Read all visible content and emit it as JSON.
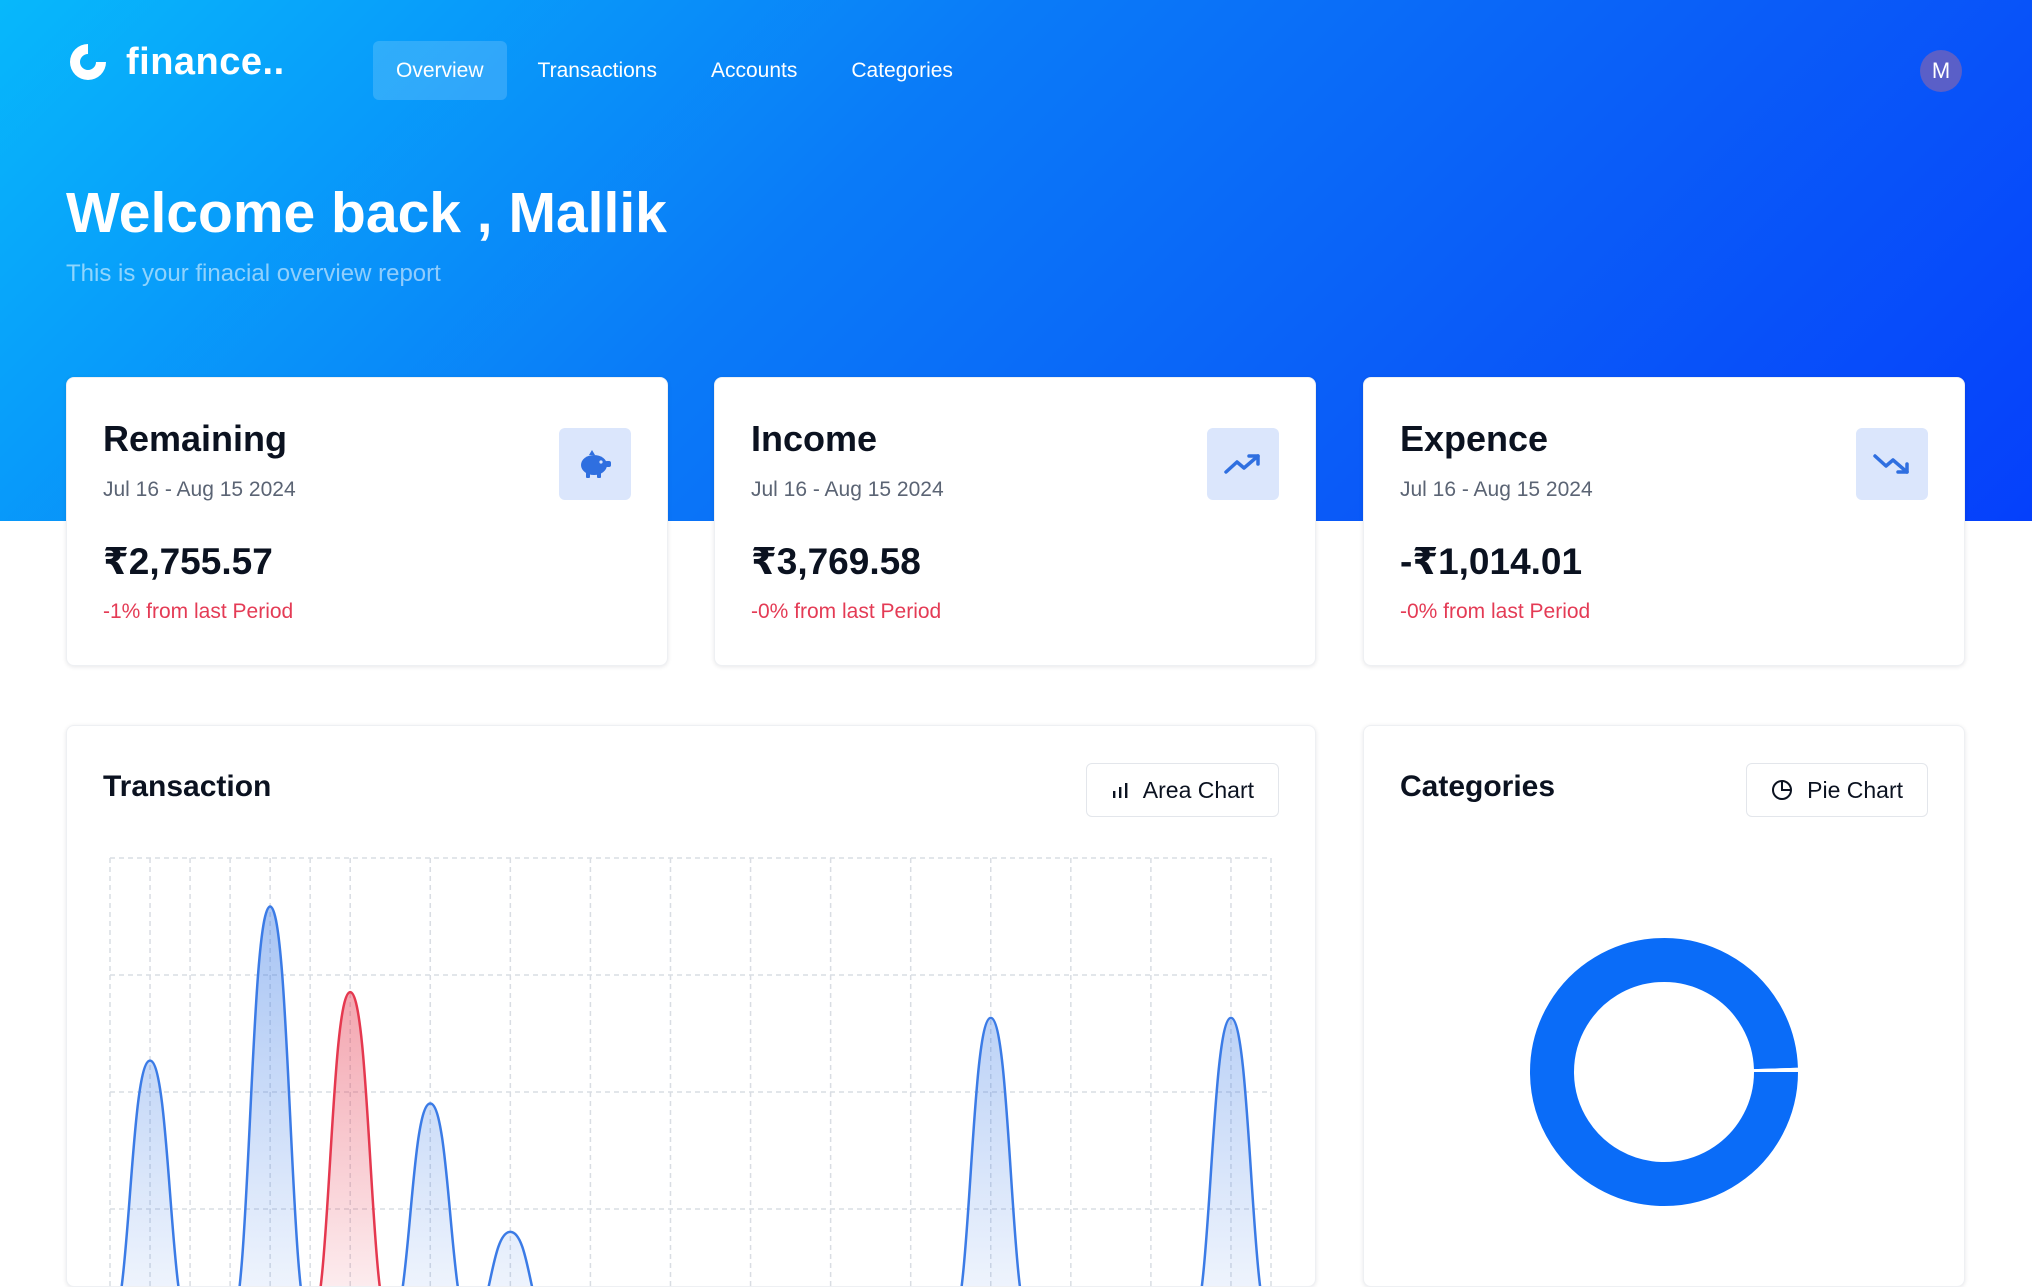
{
  "app": {
    "logo_text": "finance.."
  },
  "nav": {
    "items": [
      {
        "label": "Overview",
        "active": true
      },
      {
        "label": "Transactions",
        "active": false
      },
      {
        "label": "Accounts",
        "active": false
      },
      {
        "label": "Categories",
        "active": false
      }
    ]
  },
  "user": {
    "avatar_initial": "M"
  },
  "header": {
    "welcome": "Welcome back , Mallik",
    "subtitle": "This is your finacial overview report"
  },
  "cards": [
    {
      "title": "Remaining",
      "date": "Jul 16 - Aug 15 2024",
      "amount": "₹2,755.57",
      "change": "-1% from last Period",
      "icon": "piggy-bank-icon"
    },
    {
      "title": "Income",
      "date": "Jul 16 - Aug 15 2024",
      "amount": "₹3,769.58",
      "change": "-0% from last Period",
      "icon": "trending-up-icon"
    },
    {
      "title": "Expence",
      "date": "Jul 16 - Aug 15 2024",
      "amount": "-₹1,014.01",
      "change": "-0% from last Period",
      "icon": "trending-down-icon"
    }
  ],
  "transaction_panel": {
    "title": "Transaction",
    "button_label": "Area Chart",
    "button_icon": "bar-chart-icon"
  },
  "categories_panel": {
    "title": "Categories",
    "button_label": "Pie Chart",
    "button_icon": "pie-chart-icon"
  },
  "colors": {
    "income": "#3b7be6",
    "expense": "#e5384f",
    "accent": "#0a6cf8",
    "negative": "#e43b55"
  },
  "chart_data": [
    {
      "type": "area",
      "title": "Transaction",
      "x": [
        0,
        1,
        2,
        3,
        4,
        5,
        6,
        7,
        8,
        9,
        10,
        11,
        12,
        13,
        14,
        15,
        16,
        17,
        18,
        19,
        20,
        21,
        22,
        23,
        24,
        25,
        26,
        27,
        28,
        29
      ],
      "series": [
        {
          "values": [
            0,
            0.62,
            0,
            0,
            0.98,
            0,
            0,
            0,
            0.52,
            0,
            0.22,
            0,
            0,
            0,
            0,
            0,
            0,
            0,
            0,
            0,
            0,
            0,
            0.72,
            0,
            0,
            0,
            0,
            0,
            0.72,
            0
          ]
        },
        {
          "values": [
            0,
            0,
            0,
            0,
            0,
            0,
            0.78,
            0,
            0,
            0.06,
            0,
            0,
            0,
            0,
            0,
            0,
            0,
            0,
            0,
            0,
            0,
            0,
            0,
            0,
            0,
            0,
            0,
            0,
            0,
            0
          ]
        }
      ],
      "grid": true
    },
    {
      "type": "pie",
      "title": "Categories",
      "values": [
        99.5,
        0.5
      ]
    }
  ]
}
